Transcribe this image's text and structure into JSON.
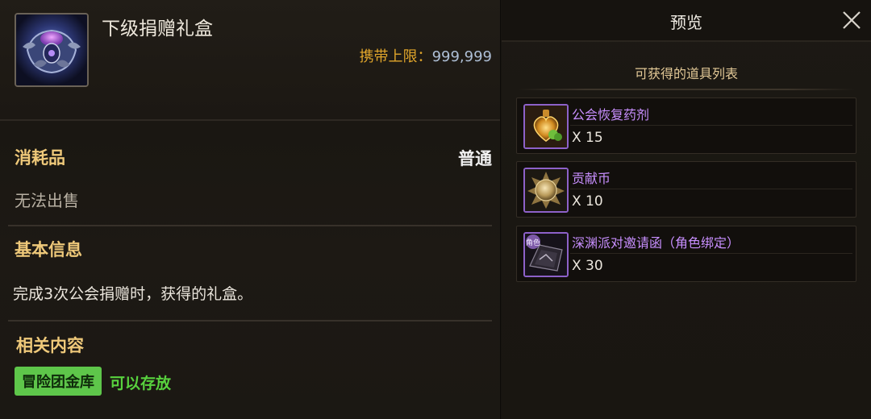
{
  "item": {
    "title": "下级捐赠礼盒",
    "carry_label": "携带上限：",
    "carry_value": "999,999",
    "category": "消耗品",
    "rarity": "普通",
    "sell_status": "无法出售",
    "basic_info_title": "基本信息",
    "description": "完成3次公会捐赠时，获得的礼盒。",
    "related_title": "相关内容",
    "storage_label": "冒险团金库",
    "storage_status": "可以存放"
  },
  "preview": {
    "title": "预览",
    "close_icon": "close-icon",
    "list_heading": "可获得的道具列表",
    "items": [
      {
        "name": "公会恢复药剂",
        "qty": "X 15",
        "icon": "potion-icon"
      },
      {
        "name": "贡献币",
        "qty": "X 10",
        "icon": "coin-icon"
      },
      {
        "name": "深渊派对邀请函（角色绑定）",
        "qty": "X 30",
        "icon": "invitation-icon",
        "badge": "角色"
      }
    ]
  },
  "colors": {
    "accent_gold": "#efc97a",
    "rare_purple": "#c88fff",
    "storage_green": "#5ec64a"
  }
}
